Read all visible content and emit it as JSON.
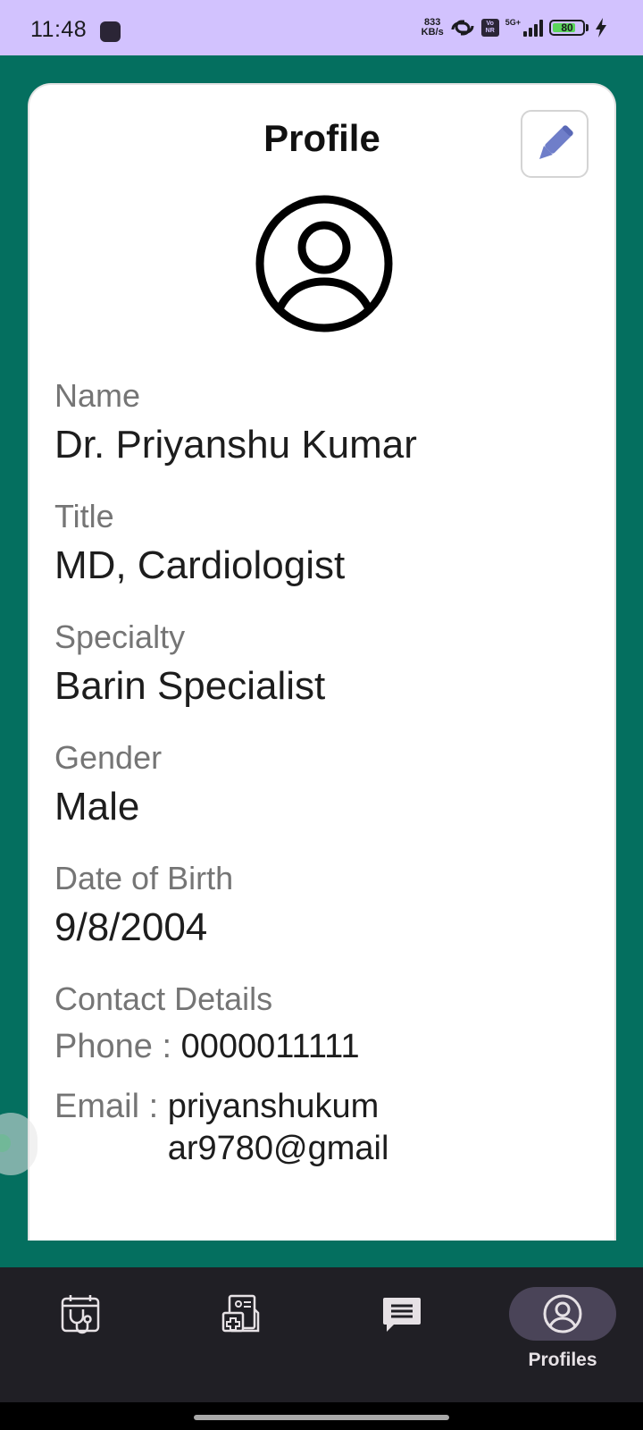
{
  "status_bar": {
    "time": "11:48",
    "net_speed_value": "833",
    "net_speed_unit": "KB/s",
    "volte_top": "Vo",
    "volte_bottom": "NR",
    "network_type": "5G+",
    "battery_level": "80",
    "battery_fraction": 0.8,
    "charging": true
  },
  "profile": {
    "title": "Profile",
    "fields": [
      {
        "label": "Name",
        "value": "Dr. Priyanshu Kumar"
      },
      {
        "label": "Title",
        "value": "MD, Cardiologist"
      },
      {
        "label": "Specialty",
        "value": "Barin Specialist"
      },
      {
        "label": "Gender",
        "value": "Male"
      },
      {
        "label": "Date of Birth",
        "value": "9/8/2004"
      }
    ],
    "contact": {
      "heading": "Contact Details",
      "phone_label": "Phone : ",
      "phone_value": "0000011111",
      "email_label": "Email : ",
      "email_value_line1": "priyanshukum",
      "email_value_line2": "ar9780@gmail"
    }
  },
  "bottom_nav": {
    "items": [
      {
        "icon": "calendar-stethoscope-icon",
        "label": ""
      },
      {
        "icon": "medical-records-icon",
        "label": ""
      },
      {
        "icon": "chat-icon",
        "label": ""
      },
      {
        "icon": "account-circle-icon",
        "label": "Profiles"
      }
    ],
    "active_index": 3
  },
  "colors": {
    "background": "#046f5f",
    "status_bar": "#d2c2fe",
    "nav_bar": "#201f25",
    "edit_icon": "#6f7ec9",
    "nav_active_pill": "#4a4458"
  }
}
